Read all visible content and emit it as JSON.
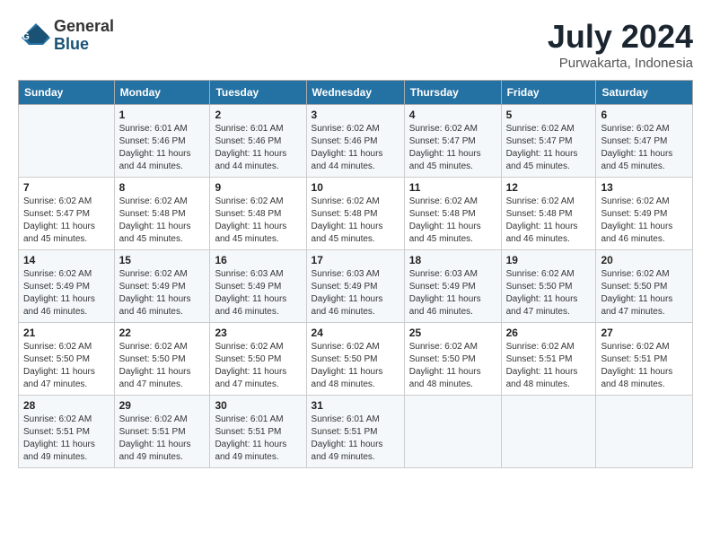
{
  "logo": {
    "general": "General",
    "blue": "Blue"
  },
  "title": "July 2024",
  "location": "Purwakarta, Indonesia",
  "headers": [
    "Sunday",
    "Monday",
    "Tuesday",
    "Wednesday",
    "Thursday",
    "Friday",
    "Saturday"
  ],
  "weeks": [
    [
      {
        "day": "",
        "info": ""
      },
      {
        "day": "1",
        "info": "Sunrise: 6:01 AM\nSunset: 5:46 PM\nDaylight: 11 hours\nand 44 minutes."
      },
      {
        "day": "2",
        "info": "Sunrise: 6:01 AM\nSunset: 5:46 PM\nDaylight: 11 hours\nand 44 minutes."
      },
      {
        "day": "3",
        "info": "Sunrise: 6:02 AM\nSunset: 5:46 PM\nDaylight: 11 hours\nand 44 minutes."
      },
      {
        "day": "4",
        "info": "Sunrise: 6:02 AM\nSunset: 5:47 PM\nDaylight: 11 hours\nand 45 minutes."
      },
      {
        "day": "5",
        "info": "Sunrise: 6:02 AM\nSunset: 5:47 PM\nDaylight: 11 hours\nand 45 minutes."
      },
      {
        "day": "6",
        "info": "Sunrise: 6:02 AM\nSunset: 5:47 PM\nDaylight: 11 hours\nand 45 minutes."
      }
    ],
    [
      {
        "day": "7",
        "info": "Sunrise: 6:02 AM\nSunset: 5:47 PM\nDaylight: 11 hours\nand 45 minutes."
      },
      {
        "day": "8",
        "info": "Sunrise: 6:02 AM\nSunset: 5:48 PM\nDaylight: 11 hours\nand 45 minutes."
      },
      {
        "day": "9",
        "info": "Sunrise: 6:02 AM\nSunset: 5:48 PM\nDaylight: 11 hours\nand 45 minutes."
      },
      {
        "day": "10",
        "info": "Sunrise: 6:02 AM\nSunset: 5:48 PM\nDaylight: 11 hours\nand 45 minutes."
      },
      {
        "day": "11",
        "info": "Sunrise: 6:02 AM\nSunset: 5:48 PM\nDaylight: 11 hours\nand 45 minutes."
      },
      {
        "day": "12",
        "info": "Sunrise: 6:02 AM\nSunset: 5:48 PM\nDaylight: 11 hours\nand 46 minutes."
      },
      {
        "day": "13",
        "info": "Sunrise: 6:02 AM\nSunset: 5:49 PM\nDaylight: 11 hours\nand 46 minutes."
      }
    ],
    [
      {
        "day": "14",
        "info": "Sunrise: 6:02 AM\nSunset: 5:49 PM\nDaylight: 11 hours\nand 46 minutes."
      },
      {
        "day": "15",
        "info": "Sunrise: 6:02 AM\nSunset: 5:49 PM\nDaylight: 11 hours\nand 46 minutes."
      },
      {
        "day": "16",
        "info": "Sunrise: 6:03 AM\nSunset: 5:49 PM\nDaylight: 11 hours\nand 46 minutes."
      },
      {
        "day": "17",
        "info": "Sunrise: 6:03 AM\nSunset: 5:49 PM\nDaylight: 11 hours\nand 46 minutes."
      },
      {
        "day": "18",
        "info": "Sunrise: 6:03 AM\nSunset: 5:49 PM\nDaylight: 11 hours\nand 46 minutes."
      },
      {
        "day": "19",
        "info": "Sunrise: 6:02 AM\nSunset: 5:50 PM\nDaylight: 11 hours\nand 47 minutes."
      },
      {
        "day": "20",
        "info": "Sunrise: 6:02 AM\nSunset: 5:50 PM\nDaylight: 11 hours\nand 47 minutes."
      }
    ],
    [
      {
        "day": "21",
        "info": "Sunrise: 6:02 AM\nSunset: 5:50 PM\nDaylight: 11 hours\nand 47 minutes."
      },
      {
        "day": "22",
        "info": "Sunrise: 6:02 AM\nSunset: 5:50 PM\nDaylight: 11 hours\nand 47 minutes."
      },
      {
        "day": "23",
        "info": "Sunrise: 6:02 AM\nSunset: 5:50 PM\nDaylight: 11 hours\nand 47 minutes."
      },
      {
        "day": "24",
        "info": "Sunrise: 6:02 AM\nSunset: 5:50 PM\nDaylight: 11 hours\nand 48 minutes."
      },
      {
        "day": "25",
        "info": "Sunrise: 6:02 AM\nSunset: 5:50 PM\nDaylight: 11 hours\nand 48 minutes."
      },
      {
        "day": "26",
        "info": "Sunrise: 6:02 AM\nSunset: 5:51 PM\nDaylight: 11 hours\nand 48 minutes."
      },
      {
        "day": "27",
        "info": "Sunrise: 6:02 AM\nSunset: 5:51 PM\nDaylight: 11 hours\nand 48 minutes."
      }
    ],
    [
      {
        "day": "28",
        "info": "Sunrise: 6:02 AM\nSunset: 5:51 PM\nDaylight: 11 hours\nand 49 minutes."
      },
      {
        "day": "29",
        "info": "Sunrise: 6:02 AM\nSunset: 5:51 PM\nDaylight: 11 hours\nand 49 minutes."
      },
      {
        "day": "30",
        "info": "Sunrise: 6:01 AM\nSunset: 5:51 PM\nDaylight: 11 hours\nand 49 minutes."
      },
      {
        "day": "31",
        "info": "Sunrise: 6:01 AM\nSunset: 5:51 PM\nDaylight: 11 hours\nand 49 minutes."
      },
      {
        "day": "",
        "info": ""
      },
      {
        "day": "",
        "info": ""
      },
      {
        "day": "",
        "info": ""
      }
    ]
  ]
}
